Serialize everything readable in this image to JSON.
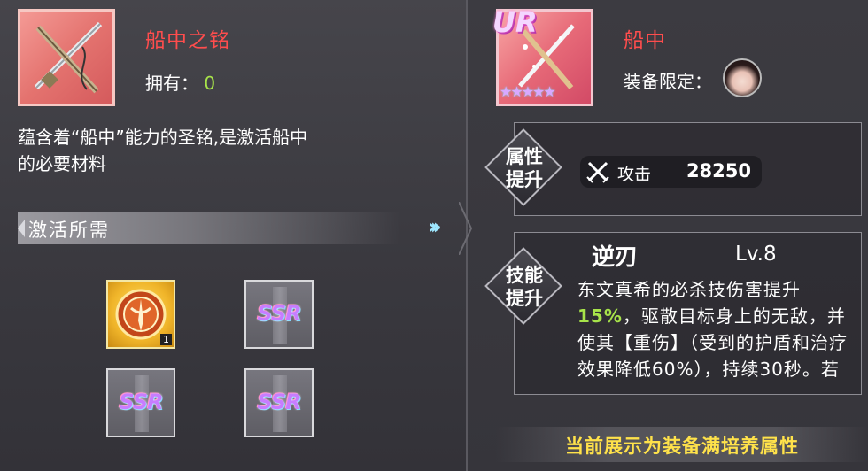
{
  "left": {
    "item_name": "船中之铭",
    "own_label": "拥有：",
    "own_value": "0",
    "description_line1": "蕴含着“船中”能力的圣铭,是激活船中",
    "description_line2": "的必要材料",
    "requirement_title": "激活所需",
    "materials": [
      {
        "kind": "emblem",
        "count": "1"
      },
      {
        "kind": "ssr",
        "label": "SSR"
      },
      {
        "kind": "ssr",
        "label": "SSR"
      },
      {
        "kind": "ssr",
        "label": "SSR"
      }
    ]
  },
  "right": {
    "rarity_badge": "UR",
    "star_count": 5,
    "equip_name": "船中",
    "restriction_label": "装备限定：",
    "attr_section_title": "属性提升",
    "attr_section_line1": "属性",
    "attr_section_line2": "提升",
    "stat": {
      "icon": "crossed-swords-icon",
      "name": "攻击",
      "value": "28250"
    },
    "skill_section_line1": "技能",
    "skill_section_line2": "提升",
    "skill": {
      "name": "逆刃",
      "level": "Lv.8",
      "desc_part1": "东文真希的必杀技伤害提升",
      "desc_highlight": "15%",
      "desc_part2": "，驱散目标身上的无敌，并使其【重伤】（受到的护盾和治疗效果降低60%），持续30秒。若"
    },
    "footer_note": "当前展示为装备满培养属性"
  },
  "colors": {
    "item_name": "#ff4d4d",
    "own_value": "#a7e34a",
    "highlight": "#a7e34a",
    "footer": "#ffe24a"
  }
}
